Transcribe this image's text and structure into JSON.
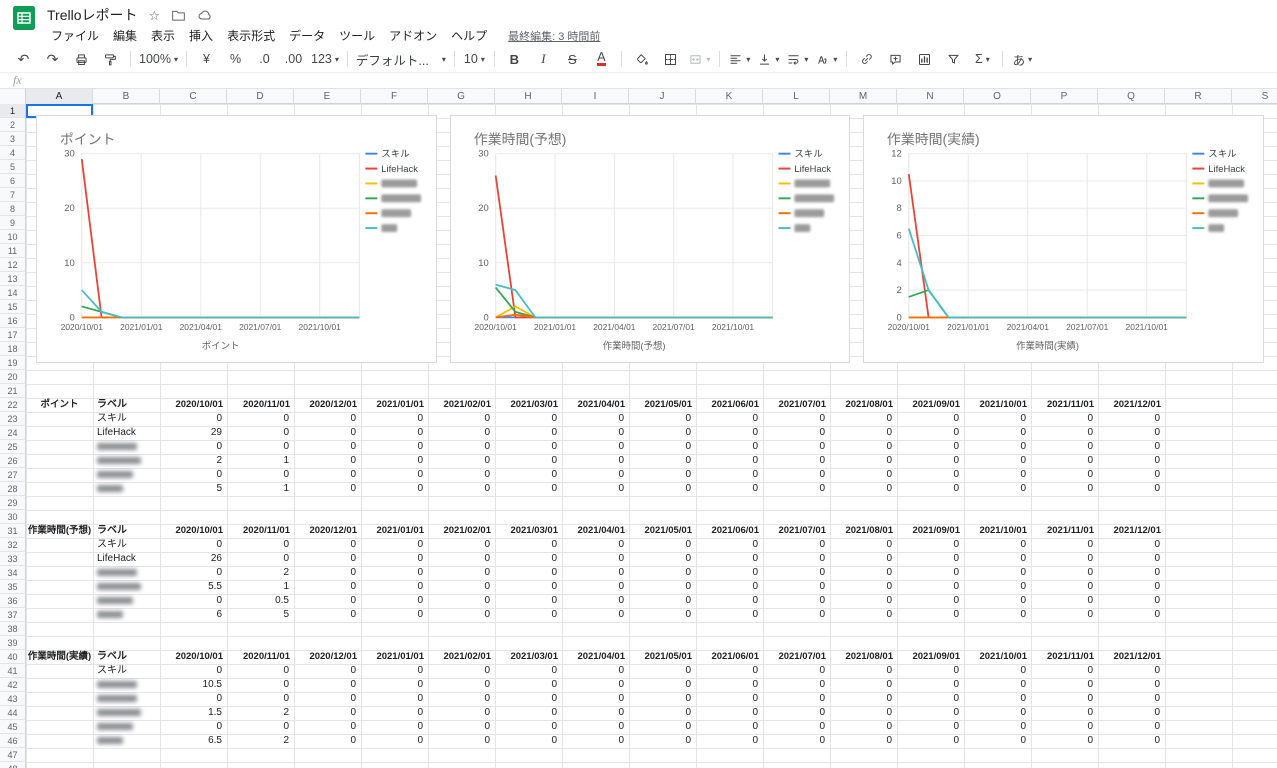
{
  "app": {
    "title": "Trelloレポート",
    "last_edit": "最終編集: 3 時間前",
    "menu": [
      "ファイル",
      "編集",
      "表示",
      "挿入",
      "表示形式",
      "データ",
      "ツール",
      "アドオン",
      "ヘルプ"
    ]
  },
  "toolbar": {
    "items": [
      {
        "name": "undo-button",
        "glyph": "↶"
      },
      {
        "name": "redo-button",
        "glyph": "↷"
      },
      {
        "name": "print-button",
        "icon": "print"
      },
      {
        "name": "paint-format-button",
        "icon": "roller"
      },
      {
        "sep": true
      },
      {
        "name": "zoom-select",
        "label": "100%",
        "caret": true
      },
      {
        "sep": true
      },
      {
        "name": "format-currency-button",
        "label": "¥"
      },
      {
        "name": "format-percent-button",
        "label": "%"
      },
      {
        "name": "decrease-decimal-button",
        "label": ".0"
      },
      {
        "name": "increase-decimal-button",
        "label": ".00"
      },
      {
        "name": "more-formats-button",
        "label": "123",
        "caret": true
      },
      {
        "sep": true
      },
      {
        "name": "font-select",
        "label": "デフォルト...",
        "caret": true
      },
      {
        "sep": true
      },
      {
        "name": "font-size-select",
        "label": "10",
        "caret": true
      },
      {
        "sep": true
      },
      {
        "name": "bold-button",
        "label": "B"
      },
      {
        "name": "italic-button",
        "label": "I"
      },
      {
        "name": "strikethrough-button",
        "label": "S"
      },
      {
        "name": "text-color-button",
        "label": "A"
      },
      {
        "sep": true
      },
      {
        "name": "fill-color-button",
        "icon": "fill"
      },
      {
        "name": "borders-button",
        "icon": "borders"
      },
      {
        "name": "merge-cells-button",
        "icon": "merge",
        "caret": true,
        "disabled": true
      },
      {
        "sep": true
      },
      {
        "name": "horizontal-align-button",
        "icon": "alignL",
        "caret": true
      },
      {
        "name": "vertical-align-button",
        "icon": "valign",
        "caret": true
      },
      {
        "name": "text-wrap-button",
        "icon": "wrap",
        "caret": true
      },
      {
        "name": "text-rotation-button",
        "icon": "rot",
        "caret": true
      },
      {
        "sep": true
      },
      {
        "name": "insert-link-button",
        "icon": "link"
      },
      {
        "name": "insert-comment-button",
        "icon": "comment"
      },
      {
        "name": "insert-chart-button",
        "icon": "chart"
      },
      {
        "name": "create-filter-button",
        "icon": "filter"
      },
      {
        "name": "functions-button",
        "label": "Σ",
        "caret": true
      },
      {
        "sep": true
      },
      {
        "name": "input-tools-button",
        "label": "あ",
        "caret": true
      }
    ]
  },
  "formula_bar": {
    "fx": "fx",
    "value": ""
  },
  "grid": {
    "columns": [
      "A",
      "B",
      "C",
      "D",
      "E",
      "F",
      "G",
      "H",
      "I",
      "J",
      "K",
      "L",
      "M",
      "N",
      "O",
      "P",
      "Q",
      "R",
      "S"
    ],
    "row_count": 48,
    "active_cell": "A1"
  },
  "months": [
    "2020/10/01",
    "2020/11/01",
    "2020/12/01",
    "2021/01/01",
    "2021/02/01",
    "2021/03/01",
    "2021/04/01",
    "2021/05/01",
    "2021/06/01",
    "2021/07/01",
    "2021/08/01",
    "2021/09/01",
    "2021/10/01",
    "2021/11/01",
    "2021/12/01"
  ],
  "tables": [
    {
      "name": "ポイント",
      "label_header": "ラベル",
      "start_row": 22,
      "rows": [
        {
          "label": "スキル",
          "redacted": false,
          "values": [
            0,
            0,
            0,
            0,
            0,
            0,
            0,
            0,
            0,
            0,
            0,
            0,
            0,
            0,
            0
          ]
        },
        {
          "label": "LifeHack",
          "redacted": false,
          "values": [
            29,
            0,
            0,
            0,
            0,
            0,
            0,
            0,
            0,
            0,
            0,
            0,
            0,
            0,
            0
          ]
        },
        {
          "label": "",
          "redacted": true,
          "label_w": 40,
          "values": [
            0,
            0,
            0,
            0,
            0,
            0,
            0,
            0,
            0,
            0,
            0,
            0,
            0,
            0,
            0
          ]
        },
        {
          "label": "",
          "redacted": true,
          "label_w": 44,
          "values": [
            2,
            1,
            0,
            0,
            0,
            0,
            0,
            0,
            0,
            0,
            0,
            0,
            0,
            0,
            0
          ]
        },
        {
          "label": "",
          "redacted": true,
          "label_w": 36,
          "values": [
            0,
            0,
            0,
            0,
            0,
            0,
            0,
            0,
            0,
            0,
            0,
            0,
            0,
            0,
            0
          ]
        },
        {
          "label": "",
          "redacted": true,
          "label_w": 26,
          "values": [
            5,
            1,
            0,
            0,
            0,
            0,
            0,
            0,
            0,
            0,
            0,
            0,
            0,
            0,
            0
          ]
        }
      ]
    },
    {
      "name": "作業時間(予想)",
      "label_header": "ラベル",
      "start_row": 31,
      "rows": [
        {
          "label": "スキル",
          "redacted": false,
          "values": [
            0,
            0,
            0,
            0,
            0,
            0,
            0,
            0,
            0,
            0,
            0,
            0,
            0,
            0,
            0
          ]
        },
        {
          "label": "LifeHack",
          "redacted": false,
          "values": [
            26,
            0,
            0,
            0,
            0,
            0,
            0,
            0,
            0,
            0,
            0,
            0,
            0,
            0,
            0
          ]
        },
        {
          "label": "",
          "redacted": true,
          "label_w": 40,
          "values": [
            0,
            2,
            0,
            0,
            0,
            0,
            0,
            0,
            0,
            0,
            0,
            0,
            0,
            0,
            0
          ]
        },
        {
          "label": "",
          "redacted": true,
          "label_w": 44,
          "values": [
            5.5,
            1,
            0,
            0,
            0,
            0,
            0,
            0,
            0,
            0,
            0,
            0,
            0,
            0,
            0
          ]
        },
        {
          "label": "",
          "redacted": true,
          "label_w": 36,
          "values": [
            0,
            0.5,
            0,
            0,
            0,
            0,
            0,
            0,
            0,
            0,
            0,
            0,
            0,
            0,
            0
          ]
        },
        {
          "label": "",
          "redacted": true,
          "label_w": 26,
          "values": [
            6,
            5,
            0,
            0,
            0,
            0,
            0,
            0,
            0,
            0,
            0,
            0,
            0,
            0,
            0
          ]
        }
      ]
    },
    {
      "name": "作業時間(実績)",
      "label_header": "ラベル",
      "start_row": 40,
      "rows": [
        {
          "label": "スキル",
          "redacted": false,
          "values": [
            0,
            0,
            0,
            0,
            0,
            0,
            0,
            0,
            0,
            0,
            0,
            0,
            0,
            0,
            0
          ]
        },
        {
          "label": "",
          "redacted": true,
          "label_w": 40,
          "values": [
            10.5,
            0,
            0,
            0,
            0,
            0,
            0,
            0,
            0,
            0,
            0,
            0,
            0,
            0,
            0
          ]
        },
        {
          "label": "",
          "redacted": true,
          "label_w": 40,
          "values": [
            0,
            0,
            0,
            0,
            0,
            0,
            0,
            0,
            0,
            0,
            0,
            0,
            0,
            0,
            0
          ]
        },
        {
          "label": "",
          "redacted": true,
          "label_w": 44,
          "values": [
            1.5,
            2,
            0,
            0,
            0,
            0,
            0,
            0,
            0,
            0,
            0,
            0,
            0,
            0,
            0
          ]
        },
        {
          "label": "",
          "redacted": true,
          "label_w": 36,
          "values": [
            0,
            0,
            0,
            0,
            0,
            0,
            0,
            0,
            0,
            0,
            0,
            0,
            0,
            0,
            0
          ]
        },
        {
          "label": "",
          "redacted": true,
          "label_w": 26,
          "values": [
            6.5,
            2,
            0,
            0,
            0,
            0,
            0,
            0,
            0,
            0,
            0,
            0,
            0,
            0,
            0
          ]
        }
      ]
    }
  ],
  "chart_data": [
    {
      "type": "line",
      "title": "ポイント",
      "xlabel": "ポイント",
      "ylabel": "",
      "ylim": [
        0,
        30
      ],
      "y_ticks": [
        0,
        10,
        20,
        30
      ],
      "grid": true,
      "legend_position": "right",
      "categories": [
        "2020/10/01",
        "2020/11/01",
        "2020/12/01",
        "2021/01/01",
        "2021/02/01",
        "2021/03/01",
        "2021/04/01",
        "2021/05/01",
        "2021/06/01",
        "2021/07/01",
        "2021/08/01",
        "2021/09/01",
        "2021/10/01",
        "2021/11/01",
        "2021/12/01"
      ],
      "x_tick_labels": [
        "2020/10/01",
        "2021/01/01",
        "2021/04/01",
        "2021/07/01",
        "2021/10/01"
      ],
      "series": [
        {
          "name": "スキル",
          "color": "#4285f4",
          "redacted": false,
          "values": [
            0,
            0,
            0,
            0,
            0,
            0,
            0,
            0,
            0,
            0,
            0,
            0,
            0,
            0,
            0
          ]
        },
        {
          "name": "LifeHack",
          "color": "#ea4335",
          "redacted": false,
          "values": [
            29,
            0,
            0,
            0,
            0,
            0,
            0,
            0,
            0,
            0,
            0,
            0,
            0,
            0,
            0
          ]
        },
        {
          "name": "",
          "color": "#fbbc04",
          "redacted": true,
          "label_w": 36,
          "values": [
            0,
            0,
            0,
            0,
            0,
            0,
            0,
            0,
            0,
            0,
            0,
            0,
            0,
            0,
            0
          ]
        },
        {
          "name": "",
          "color": "#34a853",
          "redacted": true,
          "label_w": 40,
          "values": [
            2,
            1,
            0,
            0,
            0,
            0,
            0,
            0,
            0,
            0,
            0,
            0,
            0,
            0,
            0
          ]
        },
        {
          "name": "",
          "color": "#ff6d01",
          "redacted": true,
          "label_w": 30,
          "values": [
            0,
            0,
            0,
            0,
            0,
            0,
            0,
            0,
            0,
            0,
            0,
            0,
            0,
            0,
            0
          ]
        },
        {
          "name": "",
          "color": "#46bdc6",
          "redacted": true,
          "label_w": 16,
          "values": [
            5,
            1,
            0,
            0,
            0,
            0,
            0,
            0,
            0,
            0,
            0,
            0,
            0,
            0,
            0
          ]
        }
      ]
    },
    {
      "type": "line",
      "title": "作業時間(予想)",
      "xlabel": "作業時間(予想)",
      "ylabel": "",
      "ylim": [
        0,
        30
      ],
      "y_ticks": [
        0,
        10,
        20,
        30
      ],
      "grid": true,
      "legend_position": "right",
      "categories": [
        "2020/10/01",
        "2020/11/01",
        "2020/12/01",
        "2021/01/01",
        "2021/02/01",
        "2021/03/01",
        "2021/04/01",
        "2021/05/01",
        "2021/06/01",
        "2021/07/01",
        "2021/08/01",
        "2021/09/01",
        "2021/10/01",
        "2021/11/01",
        "2021/12/01"
      ],
      "x_tick_labels": [
        "2020/10/01",
        "2021/01/01",
        "2021/04/01",
        "2021/07/01",
        "2021/10/01"
      ],
      "series": [
        {
          "name": "スキル",
          "color": "#4285f4",
          "redacted": false,
          "values": [
            0,
            0,
            0,
            0,
            0,
            0,
            0,
            0,
            0,
            0,
            0,
            0,
            0,
            0,
            0
          ]
        },
        {
          "name": "LifeHack",
          "color": "#ea4335",
          "redacted": false,
          "values": [
            26,
            0,
            0,
            0,
            0,
            0,
            0,
            0,
            0,
            0,
            0,
            0,
            0,
            0,
            0
          ]
        },
        {
          "name": "",
          "color": "#fbbc04",
          "redacted": true,
          "label_w": 36,
          "values": [
            0,
            2,
            0,
            0,
            0,
            0,
            0,
            0,
            0,
            0,
            0,
            0,
            0,
            0,
            0
          ]
        },
        {
          "name": "",
          "color": "#34a853",
          "redacted": true,
          "label_w": 40,
          "values": [
            5.5,
            1,
            0,
            0,
            0,
            0,
            0,
            0,
            0,
            0,
            0,
            0,
            0,
            0,
            0
          ]
        },
        {
          "name": "",
          "color": "#ff6d01",
          "redacted": true,
          "label_w": 30,
          "values": [
            0,
            0.5,
            0,
            0,
            0,
            0,
            0,
            0,
            0,
            0,
            0,
            0,
            0,
            0,
            0
          ]
        },
        {
          "name": "",
          "color": "#46bdc6",
          "redacted": true,
          "label_w": 16,
          "values": [
            6,
            5,
            0,
            0,
            0,
            0,
            0,
            0,
            0,
            0,
            0,
            0,
            0,
            0,
            0
          ]
        }
      ]
    },
    {
      "type": "line",
      "title": "作業時間(実績)",
      "xlabel": "作業時間(実績)",
      "ylabel": "",
      "ylim": [
        0,
        12
      ],
      "y_ticks": [
        0,
        2,
        4,
        6,
        8,
        10,
        12
      ],
      "grid": true,
      "legend_position": "right",
      "categories": [
        "2020/10/01",
        "2020/11/01",
        "2020/12/01",
        "2021/01/01",
        "2021/02/01",
        "2021/03/01",
        "2021/04/01",
        "2021/05/01",
        "2021/06/01",
        "2021/07/01",
        "2021/08/01",
        "2021/09/01",
        "2021/10/01",
        "2021/11/01",
        "2021/12/01"
      ],
      "x_tick_labels": [
        "2020/10/01",
        "2021/01/01",
        "2021/04/01",
        "2021/07/01",
        "2021/10/01"
      ],
      "series": [
        {
          "name": "スキル",
          "color": "#4285f4",
          "redacted": false,
          "values": [
            0,
            0,
            0,
            0,
            0,
            0,
            0,
            0,
            0,
            0,
            0,
            0,
            0,
            0,
            0
          ]
        },
        {
          "name": "LifeHack",
          "color": "#ea4335",
          "redacted": false,
          "values": [
            10.5,
            0,
            0,
            0,
            0,
            0,
            0,
            0,
            0,
            0,
            0,
            0,
            0,
            0,
            0
          ]
        },
        {
          "name": "",
          "color": "#fbbc04",
          "redacted": true,
          "label_w": 36,
          "values": [
            0,
            0,
            0,
            0,
            0,
            0,
            0,
            0,
            0,
            0,
            0,
            0,
            0,
            0,
            0
          ]
        },
        {
          "name": "",
          "color": "#34a853",
          "redacted": true,
          "label_w": 40,
          "values": [
            1.5,
            2,
            0,
            0,
            0,
            0,
            0,
            0,
            0,
            0,
            0,
            0,
            0,
            0,
            0
          ]
        },
        {
          "name": "",
          "color": "#ff6d01",
          "redacted": true,
          "label_w": 30,
          "values": [
            0,
            0,
            0,
            0,
            0,
            0,
            0,
            0,
            0,
            0,
            0,
            0,
            0,
            0,
            0
          ]
        },
        {
          "name": "",
          "color": "#46bdc6",
          "redacted": true,
          "label_w": 16,
          "values": [
            6.5,
            2,
            0,
            0,
            0,
            0,
            0,
            0,
            0,
            0,
            0,
            0,
            0,
            0,
            0
          ]
        }
      ]
    }
  ]
}
